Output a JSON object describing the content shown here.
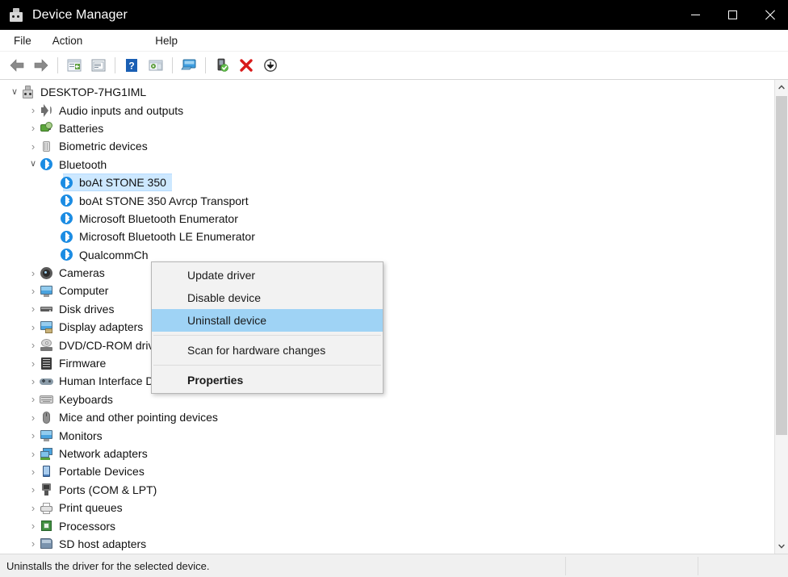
{
  "window": {
    "title": "Device Manager",
    "icon": "device-manager-icon",
    "controls": {
      "minimize": "—",
      "maximize": "☐",
      "close": "✕"
    }
  },
  "menubar": {
    "items": [
      {
        "label": "File",
        "name": "menu-file"
      },
      {
        "label": "Action",
        "name": "menu-action"
      },
      {
        "label": "Help",
        "name": "menu-help"
      }
    ]
  },
  "toolbar": {
    "buttons": [
      {
        "name": "back-button",
        "icon": "back-arrow-icon",
        "tooltip": "Back"
      },
      {
        "name": "forward-button",
        "icon": "forward-arrow-icon",
        "tooltip": "Forward"
      },
      {
        "name": "show-hide-console-tree-button",
        "icon": "console-tree-icon",
        "tooltip": "Show/Hide Console Tree"
      },
      {
        "name": "properties-button",
        "icon": "properties-window-icon",
        "tooltip": "Properties"
      },
      {
        "name": "help-button",
        "icon": "help-question-icon",
        "tooltip": "Help"
      },
      {
        "name": "view-options-button",
        "icon": "view-window-icon",
        "tooltip": "View"
      },
      {
        "name": "display-device-button",
        "icon": "monitor-screen-icon",
        "tooltip": "Display device by type"
      },
      {
        "name": "update-driver-button",
        "icon": "update-driver-icon",
        "tooltip": "Update driver"
      },
      {
        "name": "uninstall-device-button",
        "icon": "red-x-icon",
        "tooltip": "Uninstall device"
      },
      {
        "name": "scan-hardware-changes-button",
        "icon": "scan-download-icon",
        "tooltip": "Scan for hardware changes"
      }
    ]
  },
  "tree": {
    "nodes": [
      {
        "label": "DESKTOP-7HG1IML",
        "level": 0,
        "state": "expanded",
        "icon": "computer-tower-icon",
        "icon_class": "icon-pc",
        "name": "tree-node-desktop-7hg1iml"
      },
      {
        "label": "Audio inputs and outputs",
        "level": 1,
        "state": "collapsed",
        "icon": "speaker-icon",
        "icon_class": "icon-speaker",
        "name": "tree-node-audio-inputs-and-outputs"
      },
      {
        "label": "Batteries",
        "level": 1,
        "state": "collapsed",
        "icon": "battery-icon",
        "icon_class": "icon-battery",
        "name": "tree-node-batteries"
      },
      {
        "label": "Biometric devices",
        "level": 1,
        "state": "collapsed",
        "icon": "biometric-sensor-icon",
        "icon_class": "icon-bio",
        "name": "tree-node-biometric-devices"
      },
      {
        "label": "Bluetooth",
        "level": 1,
        "state": "expanded",
        "icon": "bluetooth-icon",
        "icon_class": "icon-bt",
        "name": "tree-node-bluetooth"
      },
      {
        "label": "boAt STONE 350",
        "level": 2,
        "state": "leaf",
        "icon": "bluetooth-icon",
        "icon_class": "icon-bt",
        "name": "tree-node-boat-stone-350",
        "selected": true
      },
      {
        "label": "boAt STONE 350 Avrcp Transport",
        "level": 2,
        "state": "leaf",
        "icon": "bluetooth-icon",
        "icon_class": "icon-bt",
        "name": "tree-node-boat-stone-350-avrcp"
      },
      {
        "label": "Microsoft Bluetooth Enumerator",
        "level": 2,
        "state": "leaf",
        "icon": "bluetooth-icon",
        "icon_class": "icon-bt",
        "name": "tree-node-microsoft-bluetooth-enumerator"
      },
      {
        "label": "Microsoft Bluetooth LE Enumerator",
        "level": 2,
        "state": "leaf",
        "icon": "bluetooth-icon",
        "icon_class": "icon-bt",
        "name": "tree-node-microsoft-bluetooth-le-enumerator"
      },
      {
        "label": "QualcommCh",
        "level": 2,
        "state": "leaf",
        "icon": "bluetooth-icon",
        "icon_class": "icon-bt",
        "name": "tree-node-qualcomm-bluetooth"
      },
      {
        "label": "Cameras",
        "level": 1,
        "state": "collapsed",
        "icon": "camera-icon",
        "icon_class": "icon-cam",
        "name": "tree-node-cameras"
      },
      {
        "label": "Computer",
        "level": 1,
        "state": "collapsed",
        "icon": "monitor-icon",
        "icon_class": "icon-mon",
        "name": "tree-node-computer"
      },
      {
        "label": "Disk drives",
        "level": 1,
        "state": "collapsed",
        "icon": "disk-drive-icon",
        "icon_class": "icon-disk",
        "name": "tree-node-disk-drives"
      },
      {
        "label": "Display adapters",
        "level": 1,
        "state": "collapsed",
        "icon": "display-adapter-icon",
        "icon_class": "icon-display",
        "name": "tree-node-display-adapters"
      },
      {
        "label": "DVD/CD-ROM drives",
        "level": 1,
        "state": "collapsed",
        "icon": "dvd-drive-icon",
        "icon_class": "icon-dvd",
        "name": "tree-node-dvd-cd-rom-drives"
      },
      {
        "label": "Firmware",
        "level": 1,
        "state": "collapsed",
        "icon": "firmware-icon",
        "icon_class": "icon-fw",
        "name": "tree-node-firmware"
      },
      {
        "label": "Human Interface Devices",
        "level": 1,
        "state": "collapsed",
        "icon": "hid-controller-icon",
        "icon_class": "icon-hid",
        "name": "tree-node-human-interface-devices"
      },
      {
        "label": "Keyboards",
        "level": 1,
        "state": "collapsed",
        "icon": "keyboard-icon",
        "icon_class": "icon-kb",
        "name": "tree-node-keyboards"
      },
      {
        "label": "Mice and other pointing devices",
        "level": 1,
        "state": "collapsed",
        "icon": "mouse-icon",
        "icon_class": "icon-mouse",
        "name": "tree-node-mice-and-other-pointing-devices"
      },
      {
        "label": "Monitors",
        "level": 1,
        "state": "collapsed",
        "icon": "monitor-icon",
        "icon_class": "icon-mon",
        "name": "tree-node-monitors"
      },
      {
        "label": "Network adapters",
        "level": 1,
        "state": "collapsed",
        "icon": "network-adapter-icon",
        "icon_class": "icon-net",
        "name": "tree-node-network-adapters"
      },
      {
        "label": "Portable Devices",
        "level": 1,
        "state": "collapsed",
        "icon": "portable-device-icon",
        "icon_class": "icon-port",
        "name": "tree-node-portable-devices"
      },
      {
        "label": "Ports (COM & LPT)",
        "level": 1,
        "state": "collapsed",
        "icon": "port-connector-icon",
        "icon_class": "icon-ports",
        "name": "tree-node-ports-com-and-lpt"
      },
      {
        "label": "Print queues",
        "level": 1,
        "state": "collapsed",
        "icon": "printer-icon",
        "icon_class": "icon-print",
        "name": "tree-node-print-queues"
      },
      {
        "label": "Processors",
        "level": 1,
        "state": "collapsed",
        "icon": "processor-chip-icon",
        "icon_class": "icon-cpu",
        "name": "tree-node-processors"
      },
      {
        "label": "SD host adapters",
        "level": 1,
        "state": "collapsed",
        "icon": "sd-card-icon",
        "icon_class": "icon-sd",
        "name": "tree-node-sd-host-adapters"
      }
    ],
    "twisty_collapsed": "›",
    "twisty_expanded": "∨"
  },
  "context_menu": {
    "items": [
      {
        "label": "Update driver",
        "name": "context-menu-update-driver",
        "type": "item"
      },
      {
        "label": "Disable device",
        "name": "context-menu-disable-device",
        "type": "item"
      },
      {
        "label": "Uninstall device",
        "name": "context-menu-uninstall-device",
        "type": "item",
        "highlighted": true
      },
      {
        "type": "separator",
        "name": "context-menu-separator-1"
      },
      {
        "label": "Scan for hardware changes",
        "name": "context-menu-scan-for-hardware-changes",
        "type": "item"
      },
      {
        "type": "separator",
        "name": "context-menu-separator-2"
      },
      {
        "label": "Properties",
        "name": "context-menu-properties",
        "type": "item",
        "bold": true
      }
    ]
  },
  "statusbar": {
    "text": "Uninstalls the driver for the selected device."
  },
  "scrollbar": {
    "up_arrow": "▲",
    "down_arrow": "▼"
  },
  "colors": {
    "titlebar_bg": "#000000",
    "selection_blue": "#cde8ff",
    "menu_highlight": "#9fd3f5",
    "bluetooth_blue": "#1b8ce3",
    "statusbar_bg": "#f0f0f0"
  }
}
